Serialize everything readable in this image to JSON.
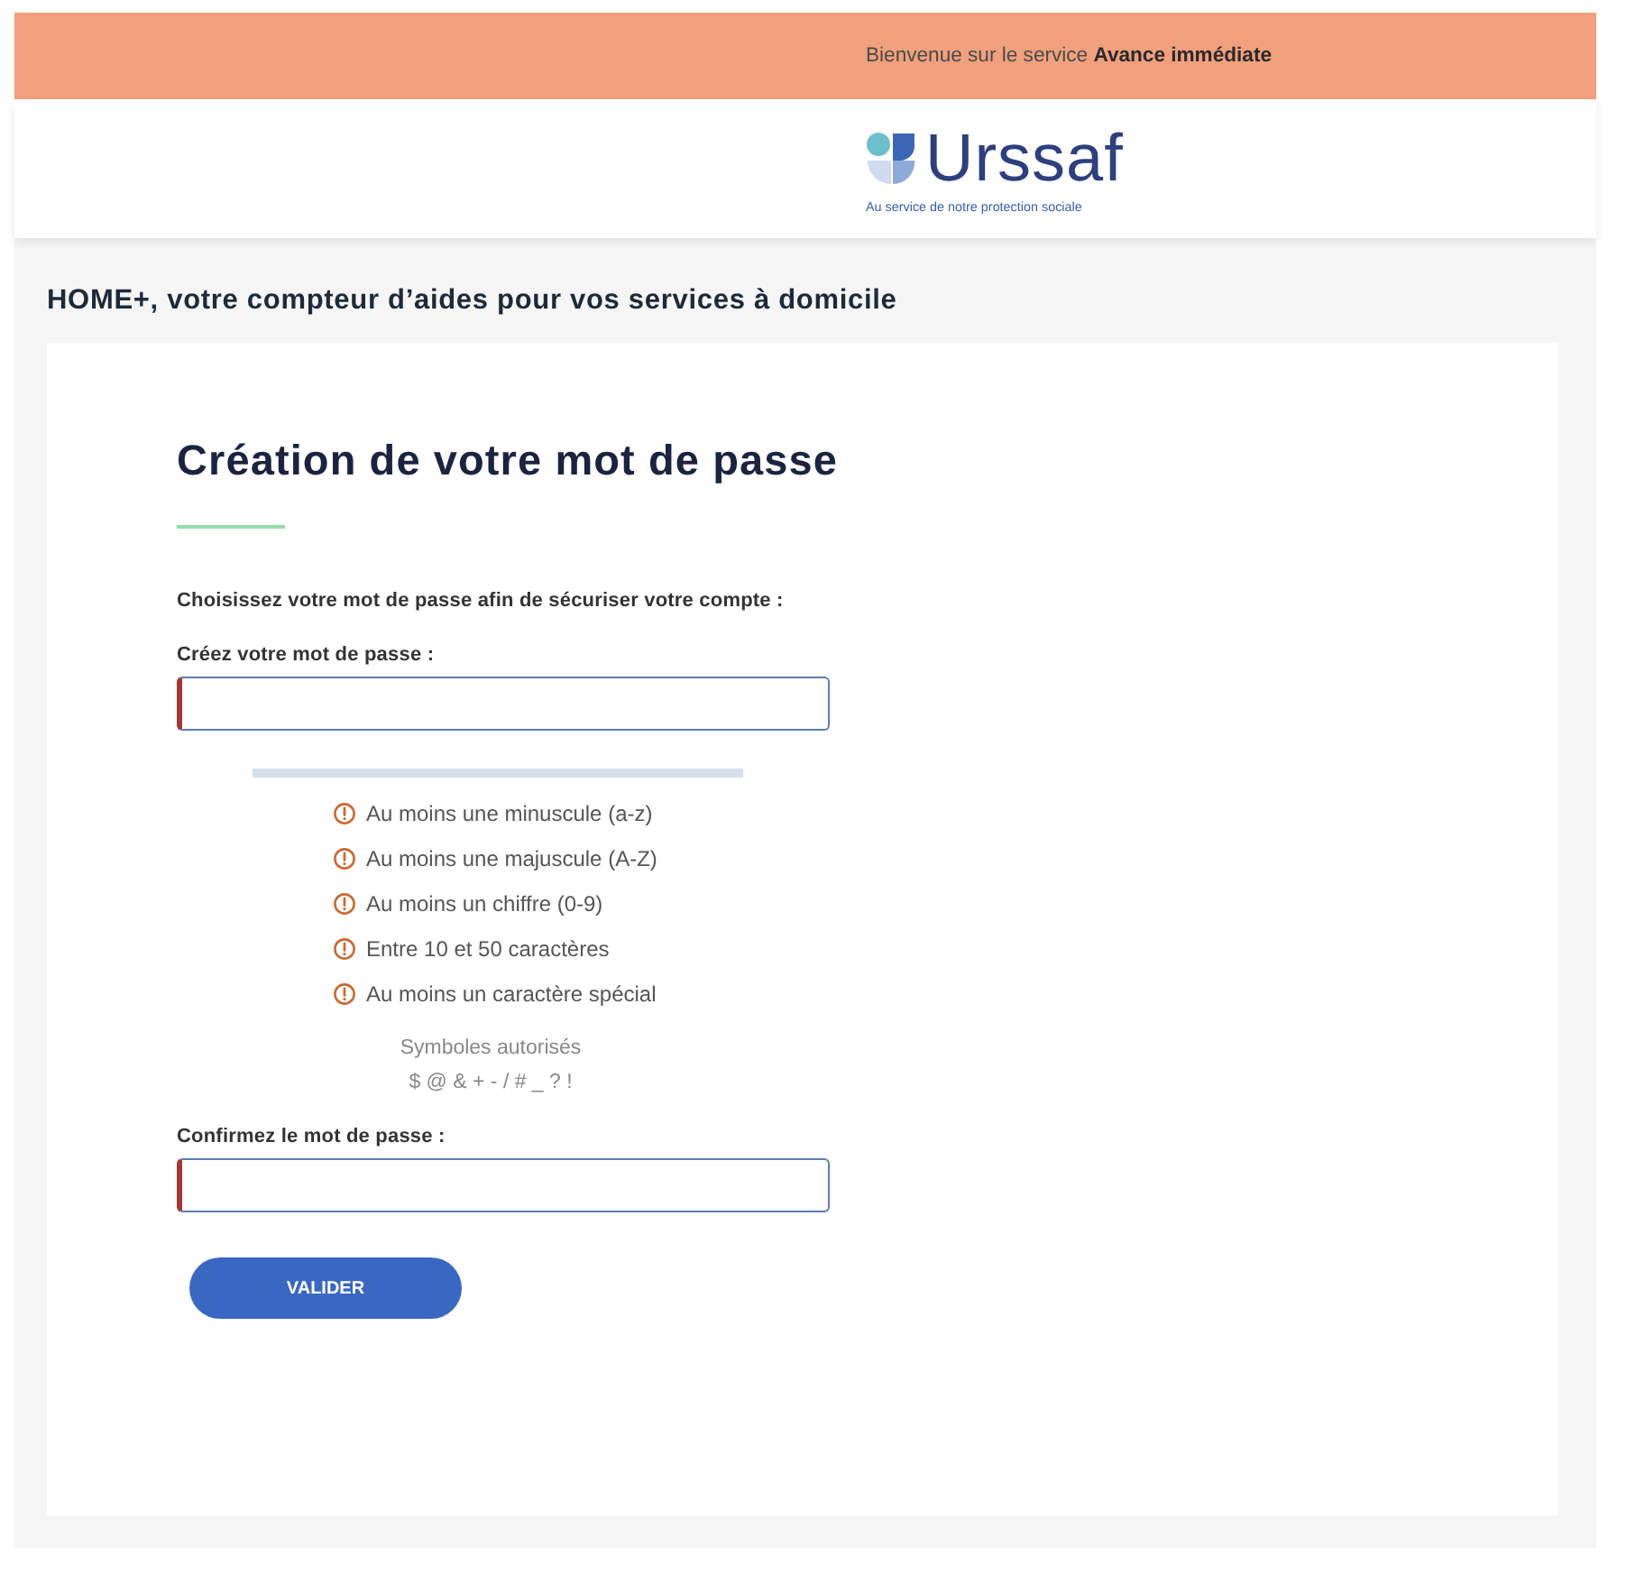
{
  "top_bar": {
    "text": "Bienvenue sur le service **Avance immédiate**"
  },
  "logo": {
    "name": "Urssaf",
    "tagline": "Au service de notre protection sociale"
  },
  "page_heading": "HOME+, votre compteur d’aides pour vos services à domicile",
  "form": {
    "title": "Création de votre mot de passe",
    "intro": "Choisissez votre mot de passe afin de sécuriser votre compte :",
    "password_field": {
      "label": "Créez votre mot de passe :",
      "invalid": true
    },
    "password_strength": {
      "level": 0
    },
    "requirements": [
      {
        "text": "Au moins une minuscule (a-z)",
        "met": false
      },
      {
        "text": "Au moins une majuscule (A-Z)",
        "met": false
      },
      {
        "text": "Au moins un chiffre (0-9)",
        "met": false
      },
      {
        "text": "Entre 10 et 50 caractères",
        "met": false
      },
      {
        "text": "Au moins un caractère spécial",
        "met": false
      }
    ],
    "allowed_symbols": {
      "label": "Symboles autorisés",
      "symbols": "$ @ & + - / # _ ? !"
    },
    "confirm_field": {
      "label": "Confirmez le mot de passe :",
      "invalid": true
    },
    "submit_button": "VALIDER"
  }
}
